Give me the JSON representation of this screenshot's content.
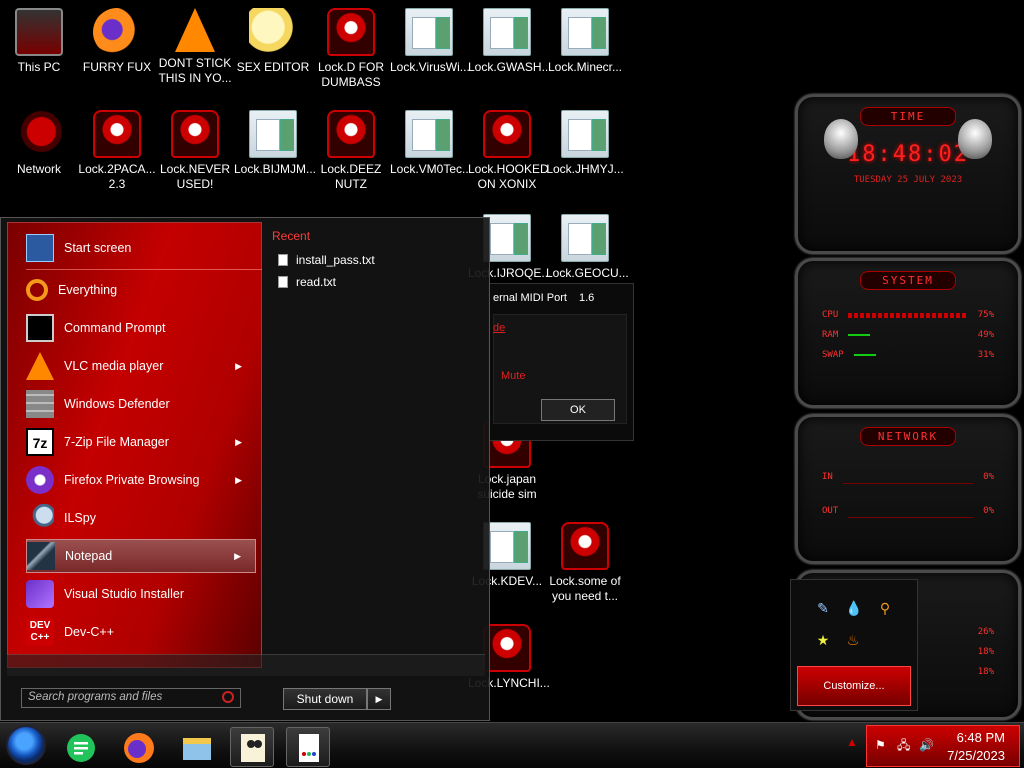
{
  "desktop": {
    "icons": [
      {
        "label": "This PC",
        "icon": "monitor-icon"
      },
      {
        "label": "FURRY FUX",
        "icon": "firefox-icon"
      },
      {
        "label": "DONT STICK THIS IN YO...",
        "icon": "vlc-icon"
      },
      {
        "label": "SEX EDITOR",
        "icon": "cartoon-icon"
      },
      {
        "label": "Lock.D FOR DUMBASS",
        "icon": "alien-icon"
      },
      {
        "label": "Lock.VirusWi...",
        "icon": "document-icon"
      },
      {
        "label": "Lock.GWASH...",
        "icon": "document-icon"
      },
      {
        "label": "Lock.Minecr...",
        "icon": "document-icon"
      },
      {
        "label": "Network",
        "icon": "network-icon"
      },
      {
        "label": "Lock.2PACA... 2.3",
        "icon": "alien-icon"
      },
      {
        "label": "Lock.NEVER USED!",
        "icon": "alien-icon"
      },
      {
        "label": "Lock.BIJMJM...",
        "icon": "document-icon"
      },
      {
        "label": "Lock.DEEZ NUTZ",
        "icon": "alien-icon"
      },
      {
        "label": "Lock.VM0Tec...",
        "icon": "document-icon"
      },
      {
        "label": "Lock.HOOKED ON XONIX",
        "icon": "alien-icon"
      },
      {
        "label": "Lock.JHMYJ...",
        "icon": "document-icon"
      },
      {
        "label": "Lock.IJROQE...",
        "icon": "document-icon"
      },
      {
        "label": "Lock.GEOCU...",
        "icon": "document-icon"
      },
      {
        "label": "Lock.japan suicide sim",
        "icon": "alien-icon"
      },
      {
        "label": "Lock.KDEV...",
        "icon": "document-icon"
      },
      {
        "label": "Lock.some of you need t...",
        "icon": "alien-icon"
      },
      {
        "label": "Lock.LYNCHI...",
        "icon": "alien-icon"
      }
    ]
  },
  "start_menu": {
    "items": [
      {
        "label": "Start screen",
        "icon": "start-screen-icon",
        "submenu": false
      },
      {
        "label": "Everything",
        "icon": "everything-search-icon",
        "submenu": false
      },
      {
        "label": "Command Prompt",
        "icon": "command-prompt-icon",
        "submenu": false
      },
      {
        "label": "VLC media player",
        "icon": "vlc-icon",
        "submenu": true
      },
      {
        "label": "Windows Defender",
        "icon": "defender-wall-icon",
        "submenu": false
      },
      {
        "label": "7-Zip File Manager",
        "icon": "7zip-icon",
        "submenu": true
      },
      {
        "label": "Firefox Private Browsing",
        "icon": "firefox-private-icon",
        "submenu": true
      },
      {
        "label": "ILSpy",
        "icon": "ilspy-icon",
        "submenu": false
      },
      {
        "label": "Notepad",
        "icon": "notepad-icon",
        "submenu": true
      },
      {
        "label": "Visual Studio Installer",
        "icon": "visual-studio-icon",
        "submenu": false
      },
      {
        "label": "Dev-C++",
        "icon": "devcpp-icon",
        "submenu": false
      }
    ],
    "selected_item": "Notepad",
    "recent_heading": "Recent",
    "recent_items": [
      "install_pass.txt",
      "read.txt"
    ],
    "search_placeholder": "Search programs and files",
    "shutdown_label": "Shut down"
  },
  "dialog": {
    "header": "ernal MIDI Port",
    "version": "1.6",
    "link_text": "de",
    "mute_label": "Mute",
    "ok_label": "OK"
  },
  "gadgets": {
    "time": {
      "title": "TIME",
      "clock": "18:48:02",
      "date": "TUESDAY 25 JULY 2023"
    },
    "system": {
      "title": "SYSTEM",
      "rows": [
        {
          "label": "CPU",
          "value": "75%"
        },
        {
          "label": "RAM",
          "value": "49%"
        },
        {
          "label": "SWAP",
          "value": "31%"
        }
      ]
    },
    "network": {
      "title": "NETWORK",
      "rows": [
        {
          "label": "IN",
          "value": "0%"
        },
        {
          "label": "OUT",
          "value": "0%"
        }
      ]
    },
    "partial": {
      "values": [
        "26%",
        "18%",
        "18%"
      ]
    }
  },
  "tray_flyout": {
    "customize_label": "Customize..."
  },
  "taskbar": {
    "pinned": [
      "start-orb",
      "chat-icon",
      "firefox-icon",
      "file-explorer-icon",
      "cartoon-app-icon",
      "document-app-icon"
    ],
    "clock_time": "6:48 PM",
    "clock_date": "7/25/2023"
  },
  "colors": {
    "accent": "#c00000",
    "text": "#ffffff",
    "alert": "#ff3030"
  }
}
